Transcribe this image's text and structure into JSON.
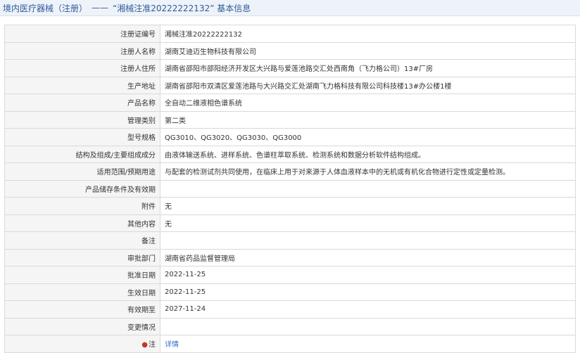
{
  "header": {
    "category": "境内医疗器械（注册）",
    "dash": "——",
    "title": "“湘械注准20222222132” 基本信息"
  },
  "rows": [
    {
      "label": "注册证编号",
      "value": "湘械注准20222222132"
    },
    {
      "label": "注册人名称",
      "value": "湖南艾迪迈生物科技有限公司"
    },
    {
      "label": "注册人住所",
      "value": "湖南省邵阳市邵阳经济开发区大兴路与爱莲池路交汇处西南角（飞力格公司）13#厂房"
    },
    {
      "label": "生产地址",
      "value": "湖南省邵阳市双清区爱莲池路与大兴路交汇处湖南飞力格科技有限公司科技楼13#办公楼1楼"
    },
    {
      "label": "产品名称",
      "value": "全自动二维液相色谱系统"
    },
    {
      "label": "管理类别",
      "value": "第二类"
    },
    {
      "label": "型号规格",
      "value": "QG3010、QG3020、QG3030、QG3000"
    },
    {
      "label": "结构及组成/主要组成成分",
      "value": "由液体输送系统、进样系统、色谱柱萃取系统、检测系统和数据分析软件结构组成。"
    },
    {
      "label": "适用范围/预期用途",
      "value": "与配套的检测试剂共同使用，在临床上用于对来源于人体血液样本中的无机或有机化合物进行定性或定量检测。"
    },
    {
      "label": "产品储存条件及有效期",
      "value": ""
    },
    {
      "label": "附件",
      "value": "无"
    },
    {
      "label": "其他内容",
      "value": "无"
    },
    {
      "label": "备注",
      "value": ""
    },
    {
      "label": "审批部门",
      "value": "湖南省药品监督管理局"
    },
    {
      "label": "批准日期",
      "value": "2022-11-25"
    },
    {
      "label": "生效日期",
      "value": "2022-11-25"
    },
    {
      "label": "有效期至",
      "value": "2027-11-24"
    },
    {
      "label": "变更情况",
      "value": ""
    }
  ],
  "note_row": {
    "label": "注",
    "link": "详情"
  }
}
